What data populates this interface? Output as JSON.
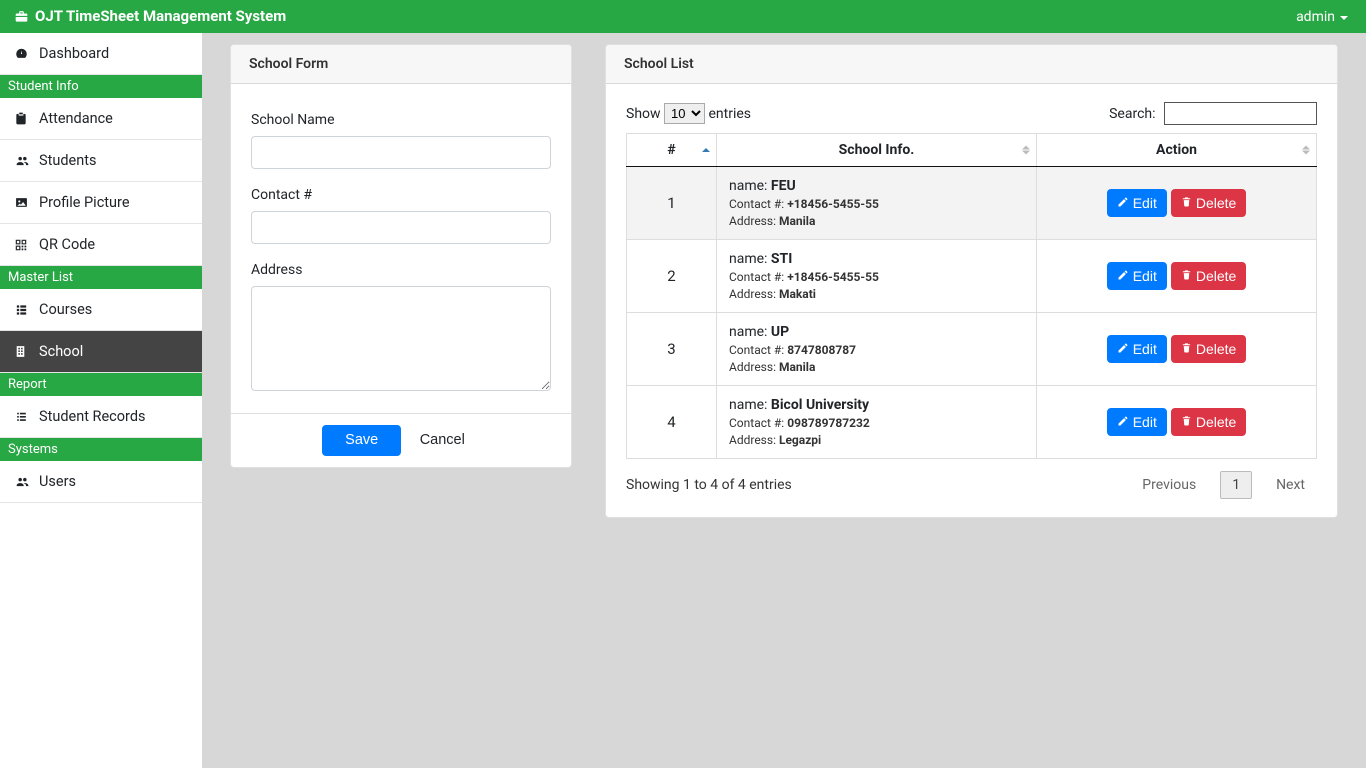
{
  "app_title": "OJT TimeSheet Management System",
  "user": {
    "name": "admin"
  },
  "sidebar": {
    "top_item": {
      "label": "Dashboard"
    },
    "sections": [
      {
        "header": "Student Info",
        "items": [
          {
            "label": "Attendance"
          },
          {
            "label": "Students"
          },
          {
            "label": "Profile Picture"
          },
          {
            "label": "QR Code"
          }
        ]
      },
      {
        "header": "Master List",
        "items": [
          {
            "label": "Courses"
          },
          {
            "label": "School"
          }
        ]
      },
      {
        "header": "Report",
        "items": [
          {
            "label": "Student Records"
          }
        ]
      },
      {
        "header": "Systems",
        "items": [
          {
            "label": "Users"
          }
        ]
      }
    ]
  },
  "form_card": {
    "title": "School Form",
    "labels": {
      "school_name": "School Name",
      "contact": "Contact #",
      "address": "Address"
    },
    "values": {
      "school_name": "",
      "contact": "",
      "address": ""
    },
    "buttons": {
      "save": "Save",
      "cancel": "Cancel"
    }
  },
  "list_card": {
    "title": "School List",
    "length_menu": {
      "show": "Show",
      "entries": "entries",
      "selected": "10"
    },
    "search_label": "Search:",
    "search_value": "",
    "columns": {
      "num": "#",
      "info": "School Info.",
      "action": "Action"
    },
    "row_labels": {
      "name": "name:",
      "contact": "Contact #:",
      "address": "Address:"
    },
    "rows": [
      {
        "num": "1",
        "name": "FEU",
        "contact": "+18456-5455-55",
        "address": "Manila"
      },
      {
        "num": "2",
        "name": "STI",
        "contact": "+18456-5455-55",
        "address": "Makati"
      },
      {
        "num": "3",
        "name": "UP",
        "contact": "8747808787",
        "address": "Manila"
      },
      {
        "num": "4",
        "name": "Bicol University",
        "contact": "098789787232",
        "address": "Legazpi"
      }
    ],
    "actions": {
      "edit": "Edit",
      "delete": "Delete"
    },
    "info_text": "Showing 1 to 4 of 4 entries",
    "pager": {
      "prev": "Previous",
      "next": "Next",
      "current": "1"
    }
  }
}
